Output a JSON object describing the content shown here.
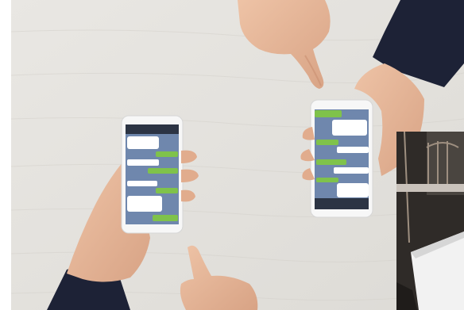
{
  "photo": {
    "subject": "two-phones-chat-on-table",
    "table_color": "#e4e2dd",
    "phone_color": "#f7f7f7",
    "screen_bg": "#6f87ad",
    "header_bar": "#2c3444",
    "bubble_out": "#7fc24b",
    "bubble_in": "#ffffff",
    "sleeve_color": "#1d2236",
    "skin_color": "#e3b598"
  },
  "inset": {
    "subject": "white-desk-with-shelf"
  }
}
